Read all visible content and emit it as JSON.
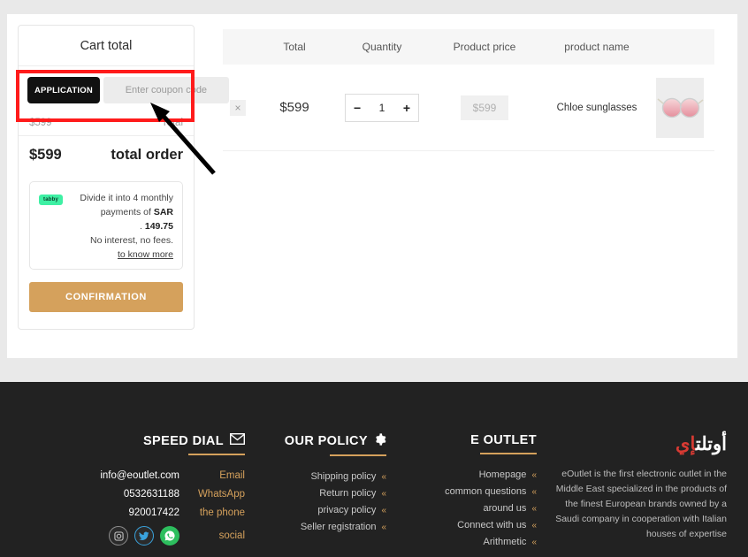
{
  "cart": {
    "title": "Cart total",
    "apply_label": "APPLICATION",
    "coupon_placeholder": "Enter coupon code",
    "coupon_value": "",
    "total_label": "Total",
    "total_value": "$599",
    "order_label": "total order",
    "order_value": "$599",
    "confirm_label": "CONFIRMATION",
    "tabby": {
      "badge": "tabby",
      "line1": "Divide it into 4 monthly",
      "line2_prefix": "payments of ",
      "line2_amount": "SAR 149.75",
      "line2_suffix": " .",
      "line3": ".No interest, no fees",
      "link": "to know more"
    }
  },
  "products": {
    "headers": {
      "remove": "",
      "total": "Total",
      "quantity": "Quantity",
      "price": "Product price",
      "name": "product name",
      "image": ""
    },
    "rows": [
      {
        "remove_label": "×",
        "total": "$599",
        "qty_minus": "−",
        "qty_value": "1",
        "qty_plus": "+",
        "price": "$599",
        "name": "Chloe sunglasses"
      }
    ]
  },
  "footer": {
    "speed_dial": {
      "title": "SPEED DIAL",
      "icon": "envelope-icon",
      "rows": [
        {
          "key": "Email",
          "value": "info@eoutlet.com"
        },
        {
          "key": "WhatsApp",
          "value": "0532631188"
        },
        {
          "key": "the phone",
          "value": "920017422"
        }
      ],
      "social_label": "social",
      "social": [
        "instagram-icon",
        "twitter-icon",
        "whatsapp-icon"
      ]
    },
    "policy": {
      "title": "OUR POLICY",
      "icon": "gear-icon",
      "items": [
        "Shipping policy",
        "Return policy",
        "privacy policy",
        "Seller registration"
      ]
    },
    "outlet": {
      "title": "E OUTLET",
      "items": [
        "Homepage",
        "common questions",
        "around us",
        "Connect with us",
        "Arithmetic"
      ]
    },
    "brand": {
      "logo_main": "أوتلت",
      "logo_accent": "إي",
      "description": "eOutlet is the first electronic outlet in the Middle East specialized in the products of the finest European brands owned by a Saudi company in cooperation with Italian houses of expertise"
    }
  },
  "colors": {
    "accent_gold": "#d5a15c",
    "footer_bg": "#222222",
    "annotation_red": "#ff1b1b",
    "tabby_green": "#3ef0a4"
  }
}
